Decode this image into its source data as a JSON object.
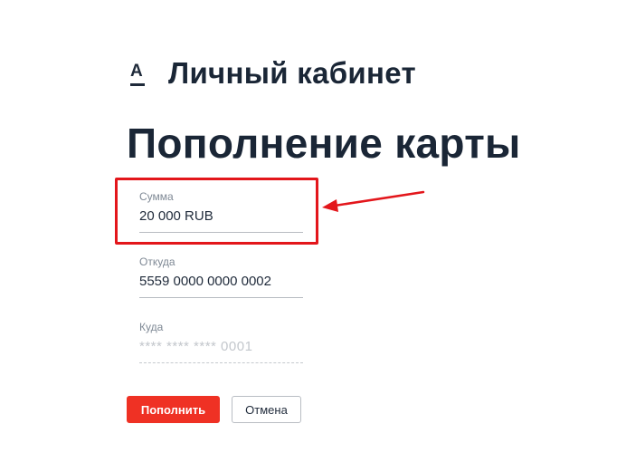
{
  "header": {
    "logo_letter": "А",
    "title": "Личный кабинет"
  },
  "page": {
    "title": "Пополнение карты"
  },
  "form": {
    "amount": {
      "label": "Сумма",
      "value": "20 000 RUB"
    },
    "from": {
      "label": "Откуда",
      "value": "5559 0000 0000 0002"
    },
    "to": {
      "label": "Куда",
      "value": "",
      "placeholder": "**** **** **** 0001"
    }
  },
  "buttons": {
    "submit_label": "Пополнить",
    "cancel_label": "Отмена"
  },
  "colors": {
    "brand_red": "#ef3124",
    "annotation_red": "#e3161b",
    "text_dark": "#1a2636"
  },
  "annotation": {
    "icon": "arrow-left-icon",
    "highlights": "amount-field"
  }
}
